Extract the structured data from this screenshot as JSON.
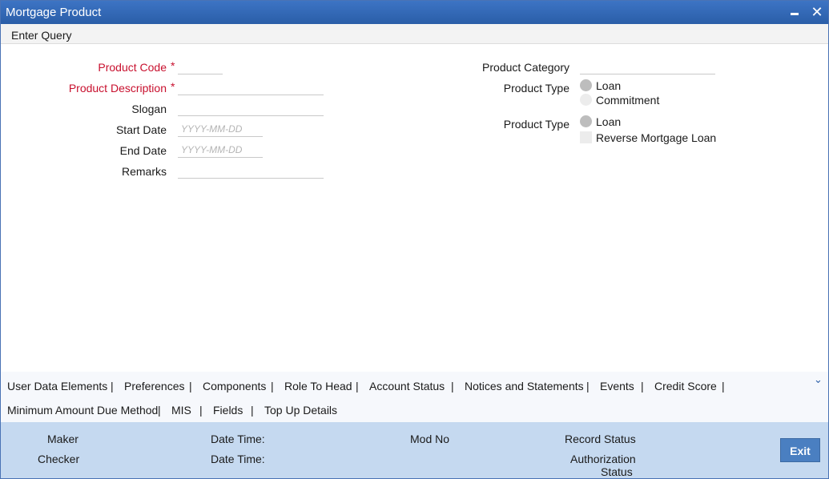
{
  "window": {
    "title": "Mortgage Product"
  },
  "toolbar": {
    "enter_query": "Enter Query"
  },
  "form": {
    "required_mark": "*",
    "product_code": {
      "label": "Product Code",
      "value": ""
    },
    "product_description": {
      "label": "Product Description",
      "value": ""
    },
    "slogan": {
      "label": "Slogan",
      "value": ""
    },
    "start_date": {
      "label": "Start Date",
      "placeholder": "YYYY-MM-DD"
    },
    "end_date": {
      "label": "End Date",
      "placeholder": "YYYY-MM-DD"
    },
    "remarks": {
      "label": "Remarks",
      "value": ""
    },
    "product_category": {
      "label": "Product Category",
      "value": ""
    },
    "product_type_1": {
      "label": "Product Type",
      "options": [
        "Loan",
        "Commitment"
      ],
      "selected": "Loan"
    },
    "product_type_2": {
      "label": "Product Type",
      "option": "Loan",
      "checkbox": "Reverse Mortgage Loan",
      "checked": false
    }
  },
  "tabs": {
    "row1": [
      "User Data Elements",
      "Preferences",
      "Components",
      "Role To Head",
      "Account Status",
      "Notices and Statements",
      "Events",
      "Credit Score"
    ],
    "row2": [
      "Minimum Amount Due Method",
      "MIS",
      "Fields",
      "Top Up Details"
    ],
    "separator": "|"
  },
  "footer": {
    "maker": "Maker",
    "checker": "Checker",
    "date_time_1": "Date Time:",
    "date_time_2": "Date Time:",
    "mod_no": "Mod No",
    "record_status": "Record Status",
    "authorization_line1": "Authorization",
    "authorization_line2": "Status",
    "exit": "Exit"
  },
  "colors": {
    "titlebar": "#2a5ea8",
    "required": "#c8102e",
    "footer": "#c5d9f0",
    "exit_button": "#4a7fc1"
  },
  "icons": {
    "minimize": "minimize-icon",
    "close": "close-icon",
    "expand": "chevron-down-icon"
  }
}
